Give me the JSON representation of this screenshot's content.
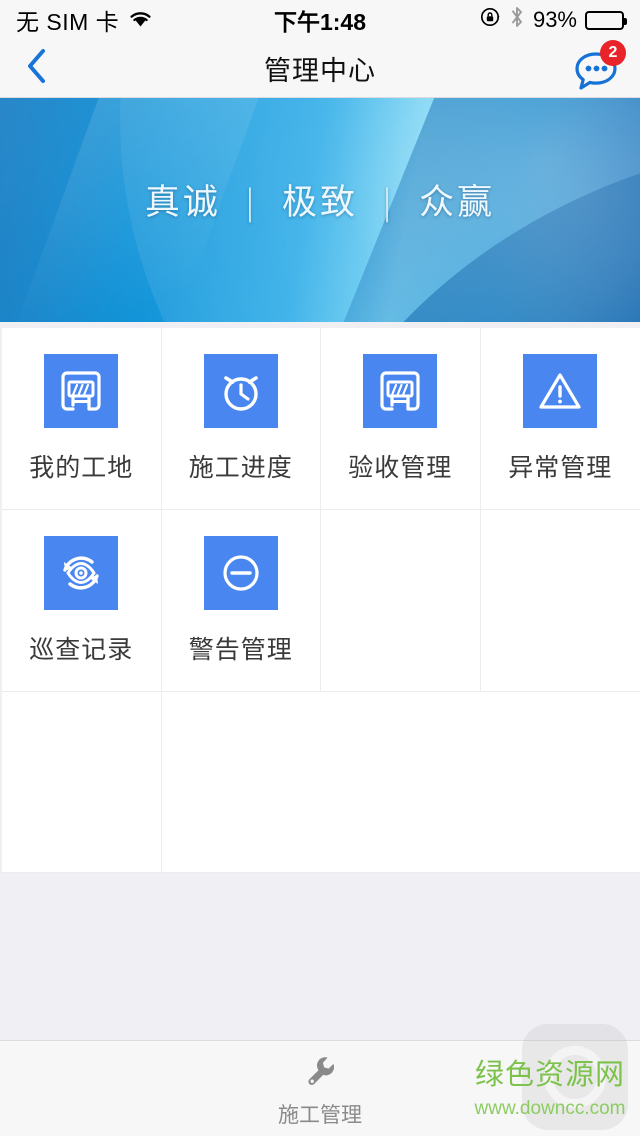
{
  "status_bar": {
    "carrier": "无 SIM 卡",
    "wifi_icon": "wifi-icon",
    "time": "下午1:48",
    "rotation_lock_icon": "rotation-lock-icon",
    "bluetooth_icon": "bluetooth-icon",
    "battery_percent": "93%",
    "battery_level": 93
  },
  "nav": {
    "back_icon": "chevron-left-icon",
    "title": "管理中心",
    "message_icon": "message-bubble-icon",
    "message_badge": "2"
  },
  "banner": {
    "word1": "真诚",
    "sep": "|",
    "word2": "极致",
    "word3": "众赢"
  },
  "grid": {
    "items": [
      {
        "label": "我的工地",
        "icon": "construction-barrier-icon"
      },
      {
        "label": "施工进度",
        "icon": "alarm-clock-icon"
      },
      {
        "label": "验收管理",
        "icon": "construction-barrier-icon"
      },
      {
        "label": "异常管理",
        "icon": "warning-triangle-icon"
      },
      {
        "label": "巡查记录",
        "icon": "eye-refresh-icon"
      },
      {
        "label": "警告管理",
        "icon": "minus-circle-icon"
      }
    ]
  },
  "tabbar": {
    "tabs": [
      {
        "label": "施工管理",
        "icon": "wrench-icon"
      }
    ]
  },
  "watermark": {
    "site_name": "绿色资源网",
    "url": "www.downcc.com"
  },
  "colors": {
    "icon_tile_blue": "#4a86f0",
    "nav_accent_blue": "#1a73d9",
    "badge_red": "#e8232a",
    "banner_blue": "#22a7e6",
    "page_bg": "#f0f0f4",
    "watermark_green": "#7cc24b"
  }
}
